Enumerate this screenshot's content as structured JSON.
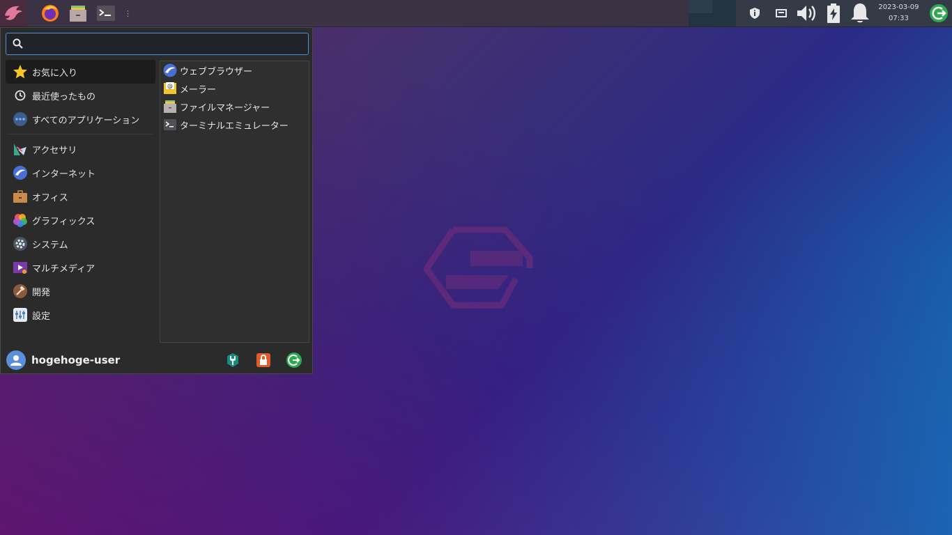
{
  "panel": {
    "launcher": "whisker-menu",
    "apps": [
      "firefox",
      "file-manager",
      "terminal"
    ],
    "clock": {
      "date": "2023-03-09",
      "time": "07:33"
    }
  },
  "menu": {
    "search": {
      "value": "",
      "placeholder": ""
    },
    "categories": [
      {
        "label": "お気に入り",
        "icon": "star-icon",
        "selected": true
      },
      {
        "label": "最近使ったもの",
        "icon": "clock-icon"
      },
      {
        "label": "すべてのアプリケーション",
        "icon": "dots-icon"
      },
      {
        "label": "アクセサリ",
        "icon": "accessories-icon"
      },
      {
        "label": "インターネット",
        "icon": "internet-icon"
      },
      {
        "label": "オフィス",
        "icon": "briefcase-icon"
      },
      {
        "label": "グラフィックス",
        "icon": "graphics-icon"
      },
      {
        "label": "システム",
        "icon": "system-gear-icon"
      },
      {
        "label": "マルチメディア",
        "icon": "multimedia-icon"
      },
      {
        "label": "開発",
        "icon": "hammer-icon"
      },
      {
        "label": "設定",
        "icon": "settings-icon"
      }
    ],
    "apps": [
      {
        "label": "ウェブブラウザー",
        "icon": "web-browser-icon"
      },
      {
        "label": "メーラー",
        "icon": "mail-icon"
      },
      {
        "label": "ファイルマネージャー",
        "icon": "file-manager-icon"
      },
      {
        "label": "ターミナルエミュレーター",
        "icon": "terminal-icon"
      }
    ],
    "user": {
      "name": "hogehoge-user"
    }
  },
  "colors": {
    "accent": "#4f8fd4",
    "lock": "#e05a2b",
    "logout": "#2ea94f"
  }
}
